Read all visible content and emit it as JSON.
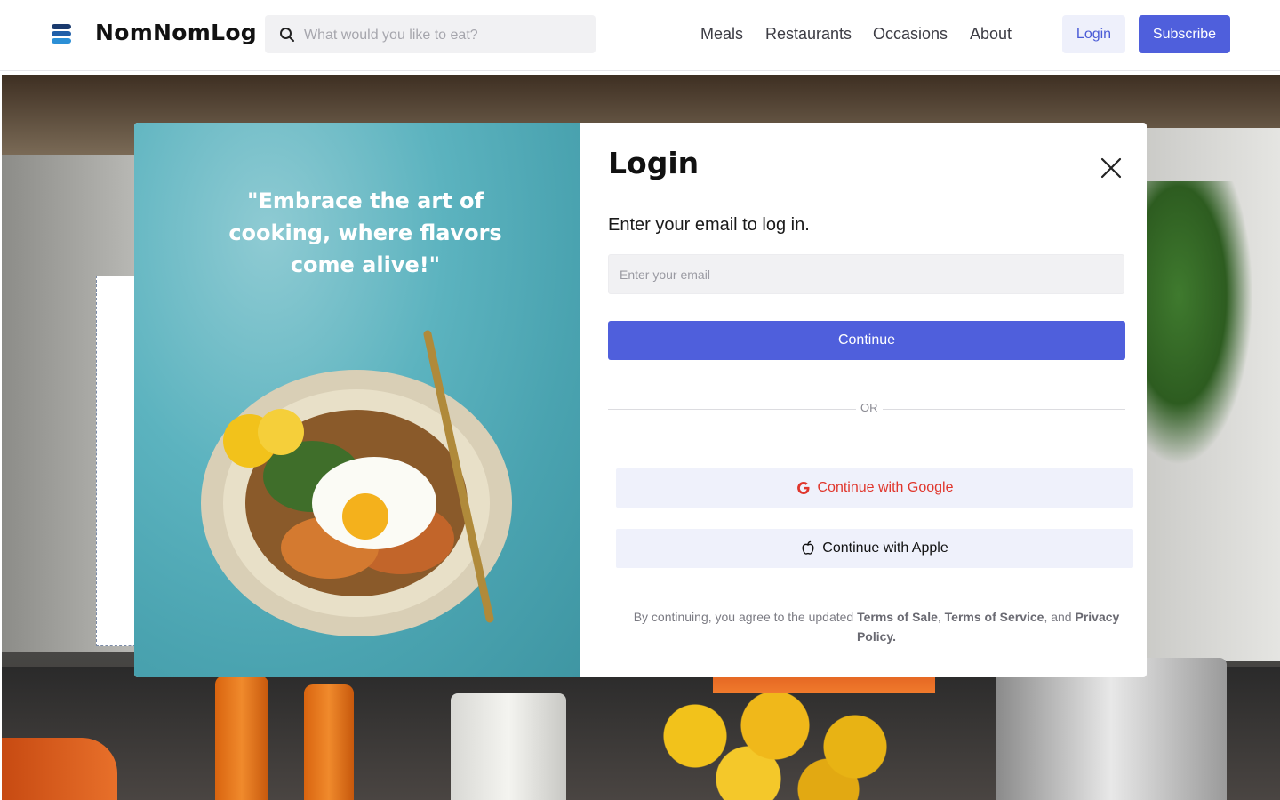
{
  "header": {
    "brand": "NomNomLog",
    "search_placeholder": "What would you like to eat?",
    "nav": [
      "Meals",
      "Restaurants",
      "Occasions",
      "About"
    ],
    "login_label": "Login",
    "subscribe_label": "Subscribe"
  },
  "modal": {
    "quote": "\"Embrace the art of cooking, where flavors come alive!\"",
    "title": "Login",
    "subtitle": "Enter your email to log in.",
    "email_placeholder": "Enter your email",
    "continue_label": "Continue",
    "or_label": "OR",
    "google_label": "Continue with Google",
    "apple_label": "Continue with Apple",
    "terms": {
      "prefix": "By continuing, you agree to the updated ",
      "sale": "Terms of Sale",
      "sep1": ", ",
      "service": "Terms of Service",
      "sep2": ", and ",
      "privacy": "Privacy Policy."
    }
  },
  "colors": {
    "accent": "#4f5fdc",
    "google_red": "#e0362c",
    "social_bg": "#eff1fb"
  },
  "icons": {
    "logo": "stack-logo-icon",
    "search": "search-icon",
    "close": "close-icon",
    "google": "google-icon",
    "apple": "apple-icon"
  }
}
